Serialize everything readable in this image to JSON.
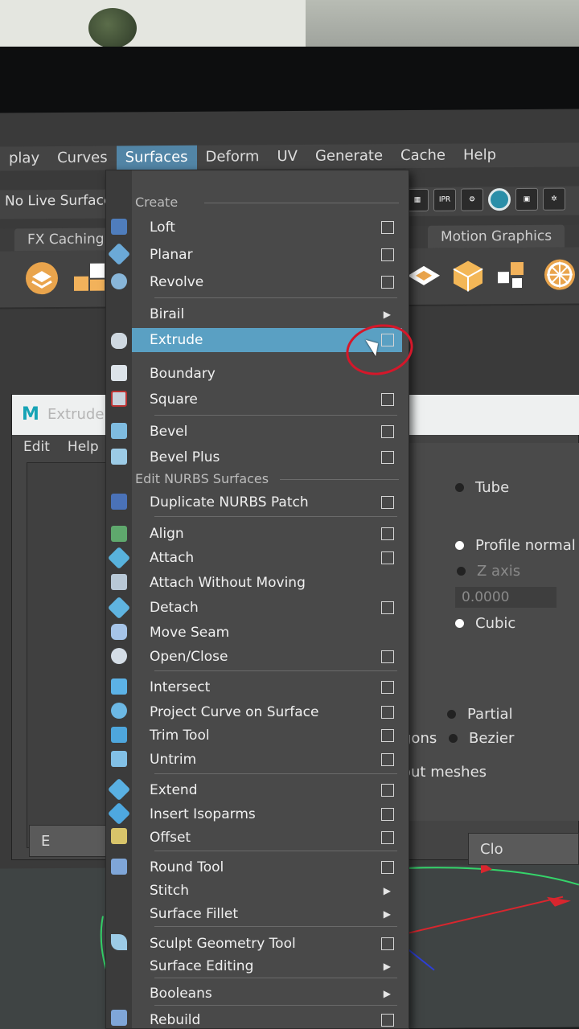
{
  "menubar": {
    "items": [
      "play",
      "Curves",
      "Surfaces",
      "Deform",
      "UV",
      "Generate",
      "Cache",
      "Help"
    ],
    "active": "Surfaces"
  },
  "statusline": {
    "live_surface": "No Live Surface",
    "ipr": "IPR"
  },
  "shelf": {
    "tabs": [
      "FX Caching",
      "Motion Graphics"
    ]
  },
  "extrude_window": {
    "logo": "M",
    "title": "Extrude O",
    "menu": [
      "Edit",
      "Help"
    ],
    "options": {
      "tube": "Tube",
      "profile_normal": "Profile normal",
      "z_axis": "Z axis",
      "cubic": "Cubic",
      "partial": "Partial",
      "bezier": "Bezier",
      "gons": "gons",
      "out_meshes": "out meshes",
      "s_label": "s"
    },
    "value": "0.0000",
    "buttons": {
      "left": "E",
      "right": "Clo"
    }
  },
  "menu": {
    "section_create": "Create",
    "section_edit": "Edit NURBS Surfaces",
    "items": [
      {
        "label": "Loft",
        "suffix": "box"
      },
      {
        "label": "Planar",
        "suffix": "box"
      },
      {
        "label": "Revolve",
        "suffix": "box"
      },
      {
        "label": "Birail",
        "suffix": "arrow"
      },
      {
        "label": "Extrude",
        "suffix": "box",
        "highlight": true
      },
      {
        "label": "Boundary",
        "suffix": "none"
      },
      {
        "label": "Square",
        "suffix": "box"
      },
      {
        "label": "Bevel",
        "suffix": "box"
      },
      {
        "label": "Bevel Plus",
        "suffix": "box"
      },
      {
        "label": "Duplicate NURBS Patch",
        "suffix": "box"
      },
      {
        "label": "Align",
        "suffix": "box"
      },
      {
        "label": "Attach",
        "suffix": "box"
      },
      {
        "label": "Attach Without Moving",
        "suffix": "none"
      },
      {
        "label": "Detach",
        "suffix": "box"
      },
      {
        "label": "Move Seam",
        "suffix": "none"
      },
      {
        "label": "Open/Close",
        "suffix": "box"
      },
      {
        "label": "Intersect",
        "suffix": "box"
      },
      {
        "label": "Project Curve on Surface",
        "suffix": "box"
      },
      {
        "label": "Trim Tool",
        "suffix": "box"
      },
      {
        "label": "Untrim",
        "suffix": "box"
      },
      {
        "label": "Extend",
        "suffix": "box"
      },
      {
        "label": "Insert Isoparms",
        "suffix": "box"
      },
      {
        "label": "Offset",
        "suffix": "box"
      },
      {
        "label": "Round Tool",
        "suffix": "box"
      },
      {
        "label": "Stitch",
        "suffix": "arrow"
      },
      {
        "label": "Surface Fillet",
        "suffix": "arrow"
      },
      {
        "label": "Sculpt Geometry Tool",
        "suffix": "box"
      },
      {
        "label": "Surface Editing",
        "suffix": "arrow"
      },
      {
        "label": "Booleans",
        "suffix": "arrow"
      },
      {
        "label": "Rebuild",
        "suffix": "box"
      }
    ]
  },
  "colors": {
    "highlight": "#5aa0c3",
    "menu_bg": "#494949",
    "annotation": "#d5172a"
  }
}
